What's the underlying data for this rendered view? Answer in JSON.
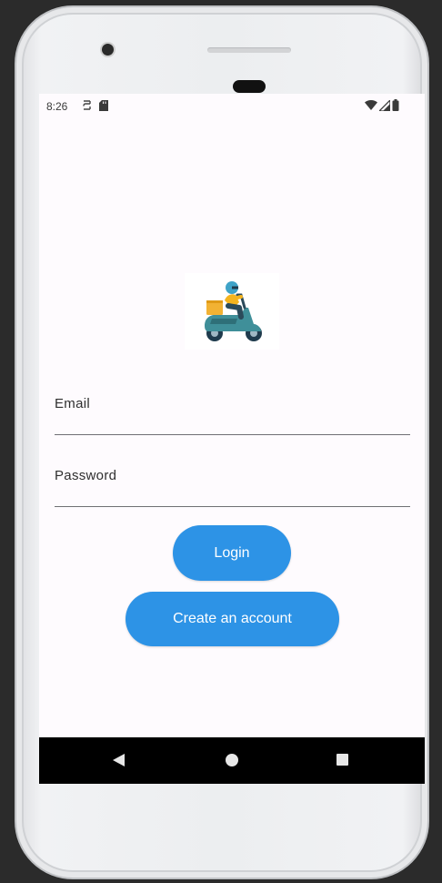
{
  "status_bar": {
    "time": "8:26",
    "left_icons": [
      "sync-icon",
      "sd-card-icon"
    ],
    "right_icons": [
      "wifi-icon",
      "signal-icon",
      "battery-icon"
    ]
  },
  "logo": {
    "icon": "delivery-scooter-icon"
  },
  "form": {
    "email_label": "Email",
    "email_value": "",
    "password_label": "Password",
    "password_value": ""
  },
  "buttons": {
    "login_label": "Login",
    "create_account_label": "Create an account"
  },
  "nav_bar": {
    "back_icon": "back-triangle-icon",
    "home_icon": "home-circle-icon",
    "recents_icon": "recents-square-icon"
  },
  "colors": {
    "accent": "#2d93e6",
    "screen_background": "#fefbfe",
    "nav_bar": "#000000"
  }
}
